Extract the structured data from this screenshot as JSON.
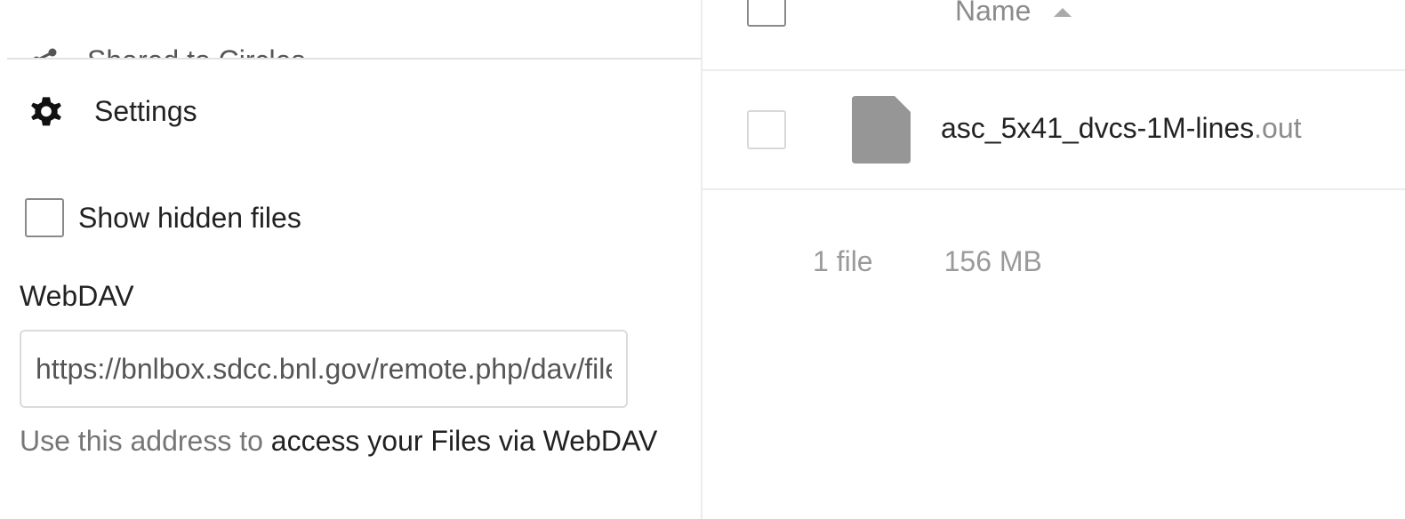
{
  "navigation": {
    "shared_peek_label": "Shared to Circles",
    "settings_label": "Settings",
    "show_hidden_label": "Show hidden files",
    "show_hidden_checked": false,
    "webdav": {
      "title": "WebDAV",
      "url": "https://bnlbox.sdcc.bnl.gov/remote.php/dav/files/",
      "hint_muted": "Use this address to ",
      "hint_link": "access your Files via WebDAV"
    }
  },
  "file_list": {
    "header_name": "Name",
    "sort_icon": "sort-ascending-icon",
    "files": [
      {
        "basename": "asc_5x41_dvcs-1M-lines",
        "extension": ".out",
        "icon": "file-icon"
      }
    ],
    "summary": {
      "file_count": "1 file",
      "total_size": "156 MB"
    }
  },
  "colors": {
    "divider": "#ececec",
    "muted_text": "#8c8c8c",
    "file_icon": "#969696"
  }
}
